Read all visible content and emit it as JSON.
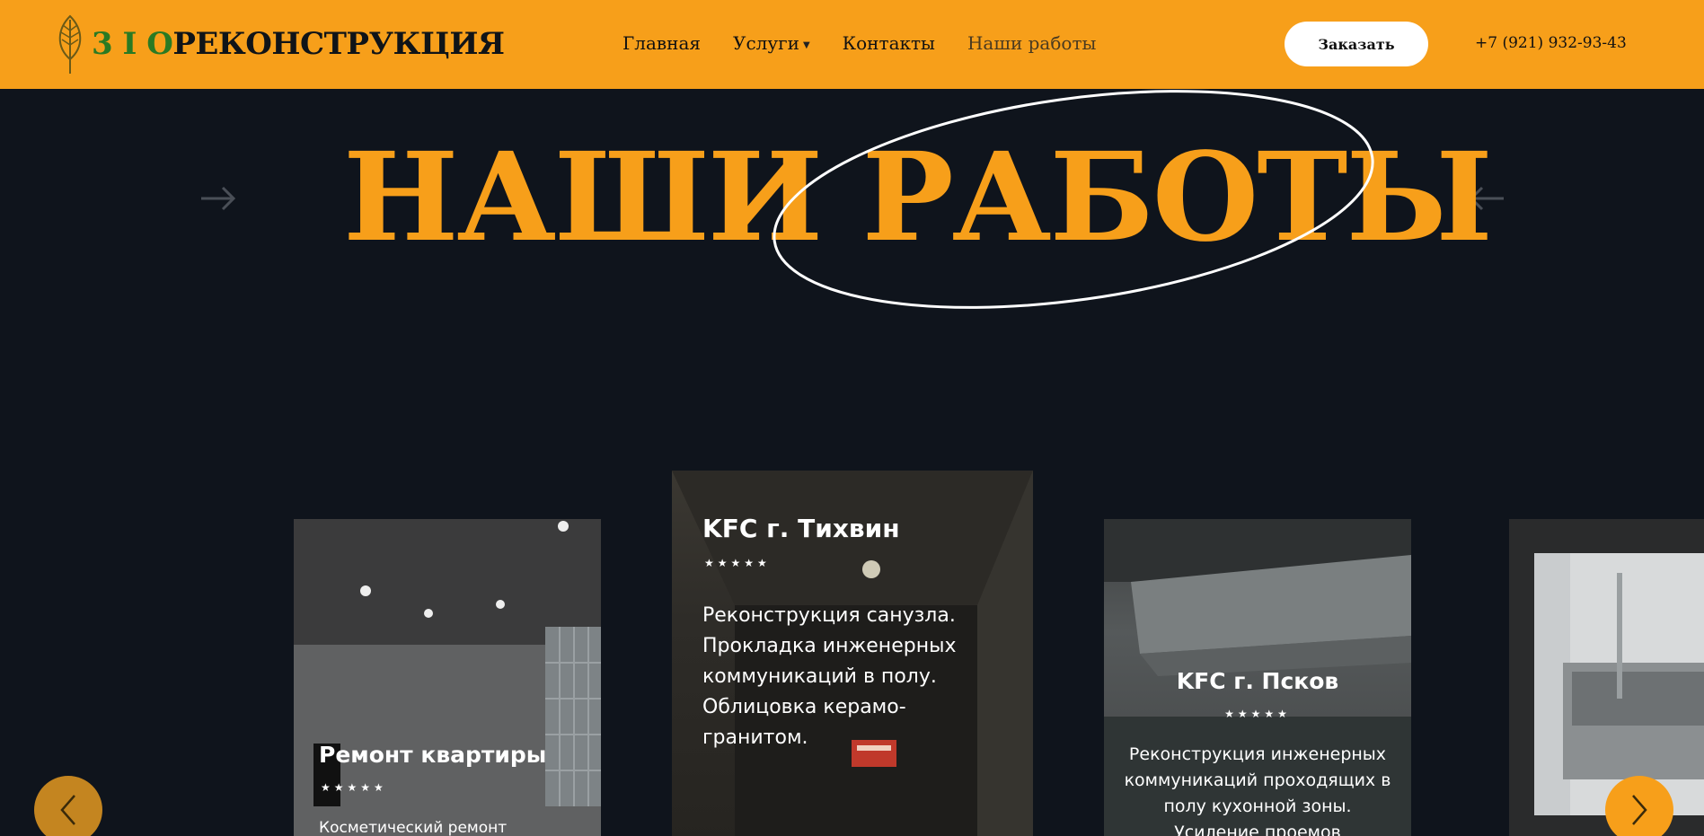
{
  "header": {
    "logo": {
      "bio": "3 I O",
      "rest": "РЕКОНСТРУКЦИЯ"
    },
    "nav": [
      {
        "label": "Главная"
      },
      {
        "label": "Услуги"
      },
      {
        "label": "Контакты"
      },
      {
        "label": "Наши работы"
      }
    ],
    "order_button": "Заказать",
    "phone": "+7 (921) 932-93-43"
  },
  "hero": {
    "title": "НАШИ РАБОТЫ"
  },
  "cards": [
    {
      "title": "Ремонт квартиры",
      "stars": "★★★★★",
      "description": "Косметический ремонт"
    },
    {
      "title": "KFC г. Тихвин",
      "stars": "★★★★★",
      "description": "Реконструкция санузла. Прокладка инженерных коммуникаций в полу. Облицовка керамо-гранитом."
    },
    {
      "title": "KFC г. Псков",
      "stars": "★★★★★",
      "description": "Реконструкция инженерных коммуникаций проходящих в полу кухонной зоны. Усиление проемов"
    }
  ],
  "colors": {
    "accent": "#f79f1a",
    "background": "#0f141c",
    "logo_green": "#2a7a23"
  },
  "icons": {
    "prev": "chevron-left-icon",
    "next": "chevron-right-icon"
  }
}
